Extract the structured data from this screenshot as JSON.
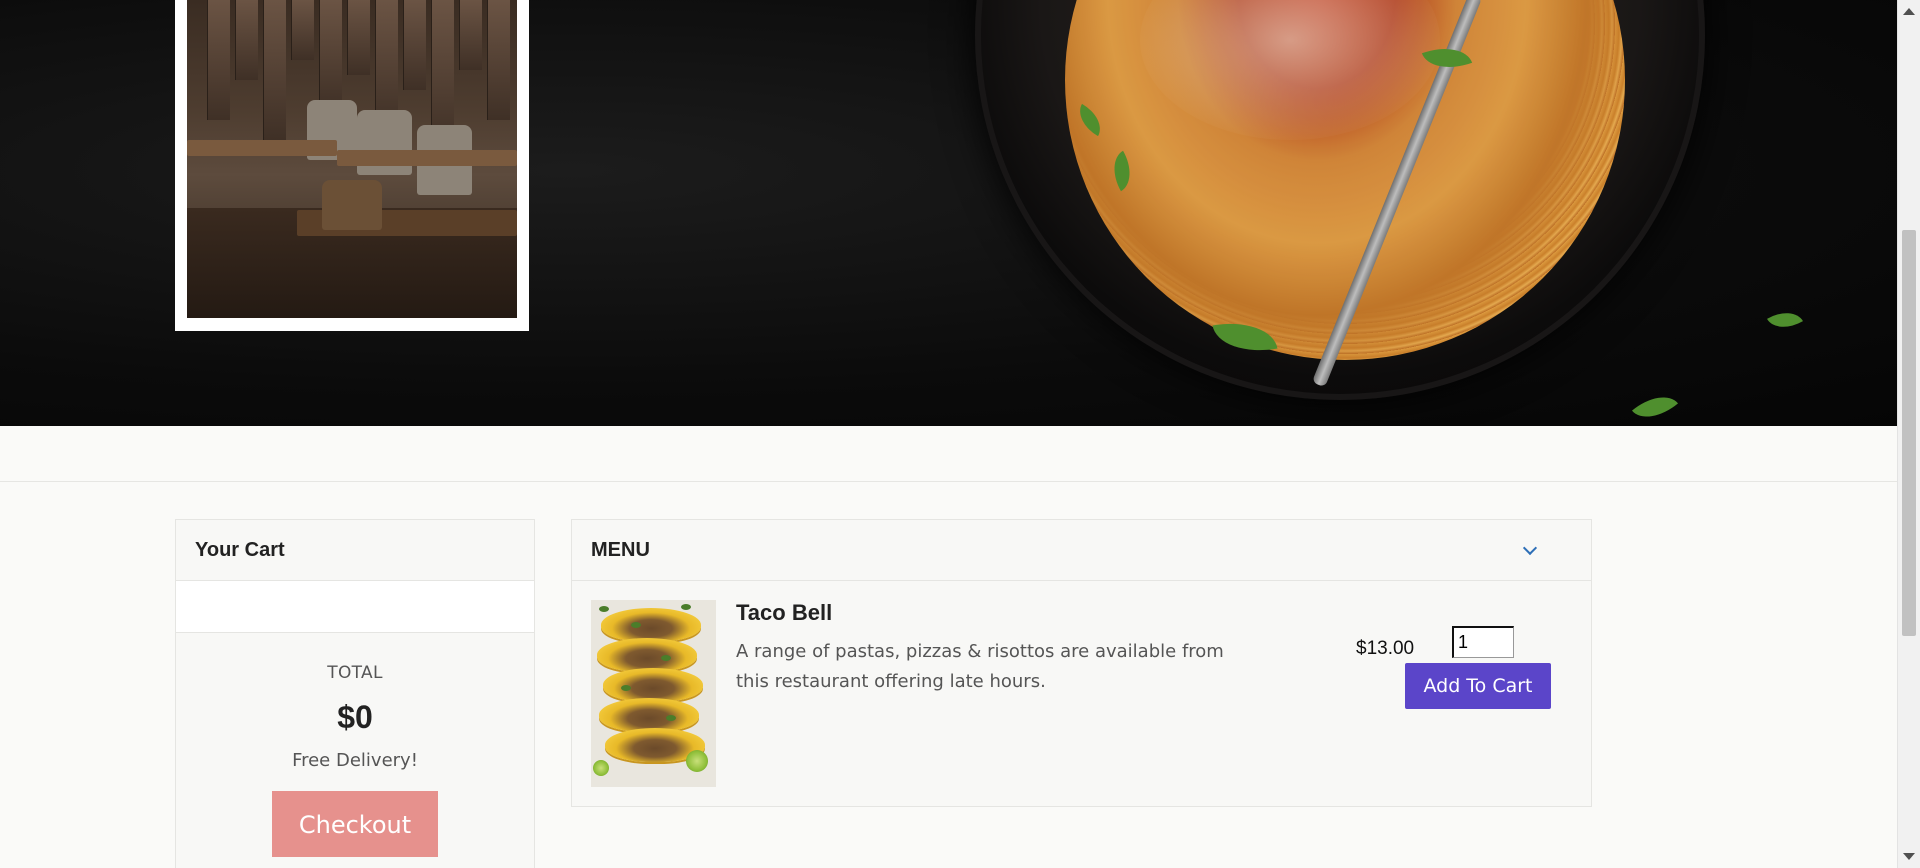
{
  "cart": {
    "title": "Your Cart",
    "total_label": "TOTAL",
    "total_value": "$0",
    "delivery_note": "Free Delivery!",
    "checkout_label": "Checkout"
  },
  "menu": {
    "title": "MENU",
    "items": [
      {
        "name": "Taco Bell",
        "description": "A range of pastas, pizzas & risottos are available from this restaurant offering late hours.",
        "price": "$13.00",
        "quantity": "1",
        "add_label": "Add To Cart"
      }
    ]
  },
  "colors": {
    "checkout_button": "#e6918d",
    "add_to_cart_button": "#5b45c9",
    "chevron": "#2e6fb7"
  }
}
